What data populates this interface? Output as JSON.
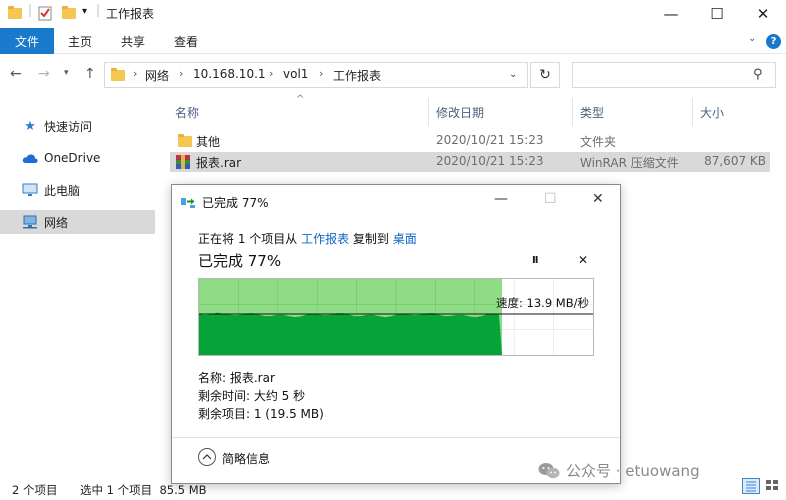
{
  "window": {
    "title": "工作报表",
    "controls": {
      "minimize": "—",
      "maximize": "☐",
      "close": "✕"
    }
  },
  "ribbon": {
    "tabs": [
      "文件",
      "主页",
      "共享",
      "查看"
    ],
    "help": "?"
  },
  "address": {
    "segments": [
      "网络",
      "10.168.10.1",
      "vol1",
      "工作报表"
    ]
  },
  "sidebar": {
    "items": [
      "快速访问",
      "OneDrive",
      "此电脑",
      "网络"
    ]
  },
  "filelist": {
    "columns": [
      "名称",
      "修改日期",
      "类型",
      "大小"
    ],
    "rows": [
      {
        "name": "其他",
        "date": "2020/10/21 15:23",
        "type": "文件夹",
        "size": ""
      },
      {
        "name": "报表.rar",
        "date": "2020/10/21 15:23",
        "type": "WinRAR 压缩文件",
        "size": "87,607 KB"
      }
    ]
  },
  "statusbar": {
    "count": "2 个项目",
    "selected": "选中 1 个项目  85.5 MB"
  },
  "dialog": {
    "title": "已完成 77%",
    "line_pre": "正在将 1 个项目从 ",
    "source": "工作报表",
    "line_mid": " 复制到 ",
    "dest": "桌面",
    "percent_label": "已完成 77%",
    "pause": "II",
    "cancel": "✕",
    "progress": 0.77,
    "speed_label": "速度: 13.9 MB/秒",
    "info": {
      "name": "名称: 报表.rar",
      "time": "剩余时间: 大约 5 秒",
      "items": "剩余项目: 1 (19.5 MB)"
    },
    "more_label": "简略信息"
  },
  "watermark": "公众号 · etuowang",
  "colors": {
    "accent": "#1979ca",
    "link": "#0f63c4",
    "progress_light": "#8fdc86",
    "progress_dark": "#06a338",
    "selection": "#d9d9d9"
  }
}
